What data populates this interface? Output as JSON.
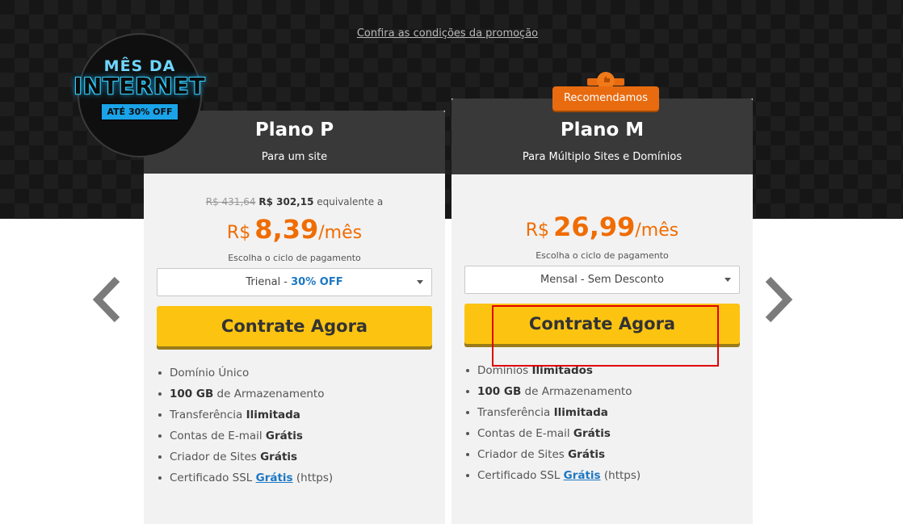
{
  "promo": {
    "link": "Confira as condições da promoção"
  },
  "badge": {
    "line1": "MÊS DA",
    "line2": "INTERNET",
    "line3": "ATÉ 30% OFF"
  },
  "colors": {
    "accent_orange": "#f06c00",
    "cta_yellow": "#fcc411",
    "link_blue": "#1d77c4",
    "highlight_red": "#e00000"
  },
  "plans": [
    {
      "name": "Plano P",
      "subtitle": "Para um site",
      "price_original": "R$ 431,64",
      "price_total": "R$ 302,15",
      "price_equiv": "equivalente a",
      "currency": "R$",
      "price": "8,39",
      "period": "/mês",
      "cycle_label": "Escolha o ciclo de pagamento",
      "cycle_value": "Trienal - ",
      "cycle_discount": "30% OFF",
      "cta": "Contrate Agora",
      "features": [
        {
          "pre": "Domínio ",
          "bold": "",
          "post": "Único"
        },
        {
          "pre": "",
          "bold": "100 GB",
          "post": " de Armazenamento"
        },
        {
          "pre": "Transferência ",
          "bold": "Ilimitada",
          "post": ""
        },
        {
          "pre": "Contas de E-mail ",
          "bold": "Grátis",
          "post": ""
        },
        {
          "pre": "Criador de Sites ",
          "bold": "Grátis",
          "post": ""
        },
        {
          "pre": "Certificado SSL ",
          "link": "Grátis",
          "post": " (https)"
        }
      ]
    },
    {
      "name": "Plano M",
      "subtitle": "Para Múltiplo Sites e Domínios",
      "ribbon": "Recomendamos",
      "currency": "R$",
      "price": "26,99",
      "period": "/mês",
      "cycle_label": "Escolha o ciclo de pagamento",
      "cycle_value": "Mensal - Sem Desconto",
      "cta": "Contrate Agora",
      "features": [
        {
          "pre": "Domínios ",
          "bold": "Ilimitados",
          "post": ""
        },
        {
          "pre": "",
          "bold": "100 GB",
          "post": " de Armazenamento"
        },
        {
          "pre": "Transferência ",
          "bold": "Ilimitada",
          "post": ""
        },
        {
          "pre": "Contas de E-mail ",
          "bold": "Grátis",
          "post": ""
        },
        {
          "pre": "Criador de Sites ",
          "bold": "Grátis",
          "post": ""
        },
        {
          "pre": "Certificado SSL ",
          "link": "Grátis",
          "post": " (https)"
        }
      ]
    }
  ],
  "icons": {
    "prev": "chevron-left-icon",
    "next": "chevron-right-icon",
    "dropdown": "caret-down-icon",
    "ribbon": "thumbs-up-icon"
  }
}
